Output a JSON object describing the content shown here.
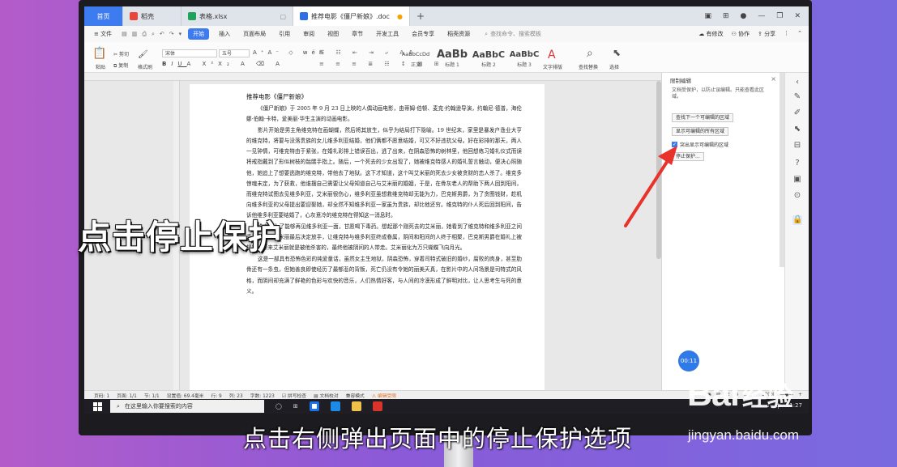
{
  "tabs": {
    "home": "首页",
    "tab1": "稻壳",
    "tab2": "表格.xlsx",
    "tab3": "推荐电影《僵尸新娘》.doc",
    "plus": "+"
  },
  "menu": {
    "file": "文件",
    "start": "开始",
    "insert": "插入",
    "layout": "页面布局",
    "refs": "引用",
    "review": "审阅",
    "view": "视图",
    "chapter": "章节",
    "devtools": "开发工具",
    "member": "会员专享",
    "resources": "稻壳资源",
    "search_placeholder": "查找命令、搜索模板",
    "unsaved": "有修改",
    "collab": "协作",
    "share": "分享"
  },
  "ribbon": {
    "paste": "粘贴",
    "cut": "剪切",
    "copy": "复制",
    "format_painter": "格式刷",
    "font_name": "宋体",
    "font_size": "五号",
    "styles": [
      {
        "preview": "AaBbCcDd",
        "label": "正文",
        "color": "#222222"
      },
      {
        "preview": "AaBb",
        "label": "标题 1",
        "color": "#111111"
      },
      {
        "preview": "AaBbC",
        "label": "标题 2",
        "color": "#111111"
      },
      {
        "preview": "AaBbC",
        "label": "标题 3",
        "color": "#111111"
      }
    ],
    "text_layout": "文字排版",
    "find_replace": "查找替换",
    "select": "选择"
  },
  "document": {
    "title": "推荐电影《僵尸新娘》",
    "paragraphs": [
      "《僵尸新娘》于 2005 年 9 月 23 日上映的人偶动画电影，由蒂姆·伯顿、麦克·约翰逊导演，约翰尼·德普，海伦娜·伯翰·卡特，爱美丽·华生主演的动画电影。",
      "影片开始是男主角维克特在画蝴蝶，然后将其放生，似乎为结局打下隐喻。19 世纪末，家里是暴发户渔业大亨的维克特，将要与没落贵族的女儿维多利亚结婚，他们俩都不愿意结婚，可又不好违抗父母。好在彩排的那天，两人一见钟情，可维克特由于紧张，在婚礼彩排上错误百出，逃了出来，在阴森恐怖的树林里，他回想练习婚礼仪式而误将戒指戴到了形似树枝的骷髅手指上。随后，一个死去的少女出现了，她被维克特感人的婚礼誓言触动，便决心照随他，她追上了想要逃跑的维克特，带他去了地狱。这下才知道，这个叫艾米丽的死去少女被贪财的恋人杀了。维克多惊魂未定，为了获救，他谁摆自己需要让父母知道自己与艾米丽的婚姻，于是，在骨灰老人的帮助下两人回到阳间，而维克特试图去见维多利亚，艾米丽很伤心，维多利亚虽想救维克特却无能为力，巴克斯男爵，为了贪图钱财，趁机向维多利亚的父母提出要迎娶她，却全然不知维多利亚一家虽为贵族，却比他还穷。维克特的仆人死后回到阳间，告诉他维多利亚要结婚了，心灰意冷的维克特在得知这一消息时。",
      "维克特为了能够再见维多利亚一面，甘愿喝下毒药。想起那个刚死去的艾米丽，她看到了维克特和维多利亚之间真诚的爱，艾米丽最后决定放手，让维克特与维多利亚终成眷属，阴间和阳间的人终于相聚，巴克斯男爵在婚礼上被揭穿，原来艾米丽就是被他杀害的，最终他被阴间的人带走。艾米丽化为万只蝴蝶飞向月光。",
      "这是一部具有恐怖色彩的纯爱童话，虽然女主生地狱，阴森恐怖，穿着司特式破旧的婚纱，腐败的肉身，甚至肋骨还有一条虫，但她善良即使经历了最郁悲的背叛，死亡仍没有令她的丽美天真，在影片中的人间场景是司特式的风格，而阴间却充满了鲜艳的色彩与欢快的音乐，人们热情好客，与人间的冷漠形成了鲜明对比，让人思考生与死的意义。"
    ]
  },
  "pane": {
    "title": "限制编辑",
    "description": "文档受保护，以防止误编辑。只能查看此区域。",
    "btn_next": "查找下一个可编辑的区域",
    "btn_show_all": "显示可编辑的所有区域",
    "highlight_label": "突出显示可编辑的区域",
    "btn_stop": "停止保护..."
  },
  "status": {
    "page": "页码: 1",
    "pages": "页面: 1/1",
    "section": "节: 1/1",
    "setting": "设置值: 69.4毫米",
    "row": "行: 9",
    "col": "列: 23",
    "words": "字数: 1223",
    "spell": "拼写检查",
    "doc_check": "文档校对",
    "compat": "兼容模式",
    "editing": "编辑受限",
    "zoom": "100%"
  },
  "taskbar": {
    "search_placeholder": "在这里输入你要搜索的内容",
    "ime": "中",
    "time": "11:27"
  },
  "timer": "00:11",
  "overlay_big": "点击停止保护",
  "subtitle": "点击右侧弹出页面中的停止保护选项",
  "watermark": {
    "logo": "Bai",
    "cn": "经验",
    "url": "jingyan.baidu.com"
  }
}
